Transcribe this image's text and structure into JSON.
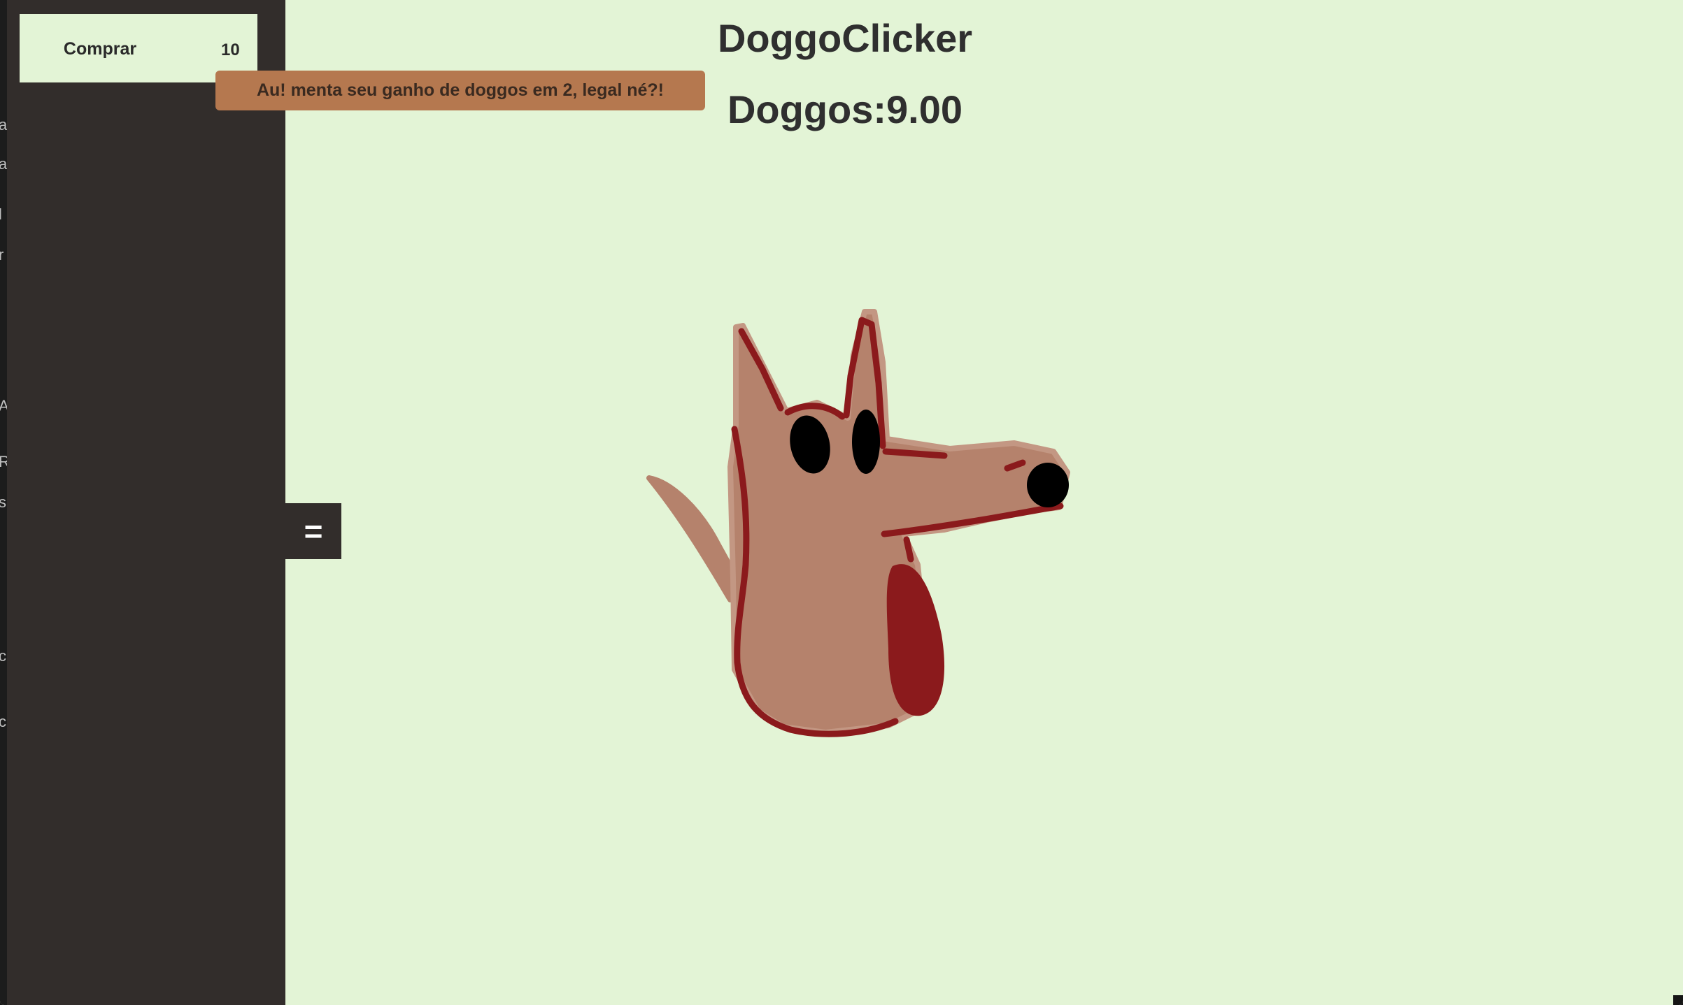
{
  "app": {
    "title": "DoggoClicker",
    "counter_text": "Doggos:9.00"
  },
  "sidebar": {
    "items": [
      {
        "buy_label": "Comprar",
        "price": "10"
      }
    ],
    "toggle_label": "="
  },
  "tooltip": {
    "text": "Au! menta seu ganho de doggos em 2, legal né?!"
  },
  "left_edge_text": [
    "a",
    "a",
    "l",
    "r",
    "A",
    "R",
    "s",
    "c",
    "c"
  ],
  "colors": {
    "background": "#e3f4d6",
    "sidebar": "#322d2b",
    "tooltip": "#b5784f",
    "dog_body": "#b5826c",
    "dog_outline": "#8b1a1c",
    "text": "#2f2f2f"
  }
}
